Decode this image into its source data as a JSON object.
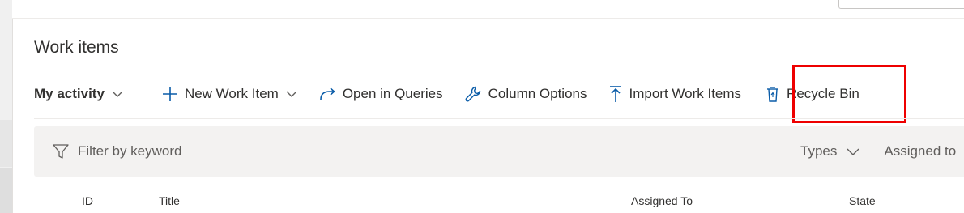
{
  "page": {
    "title": "Work items"
  },
  "toolbar": {
    "view_selector": "My activity",
    "new_work_item": "New Work Item",
    "open_in_queries": "Open in Queries",
    "column_options": "Column Options",
    "import_work_items": "Import Work Items",
    "recycle_bin": "Recycle Bin"
  },
  "filter": {
    "placeholder": "Filter by keyword",
    "types": "Types",
    "assigned_to": "Assigned to"
  },
  "table": {
    "columns": [
      "ID",
      "Title",
      "Assigned To",
      "State"
    ]
  },
  "colors": {
    "highlight": "#ee0000",
    "filter_bg": "#f3f2f1",
    "text": "#323130"
  }
}
